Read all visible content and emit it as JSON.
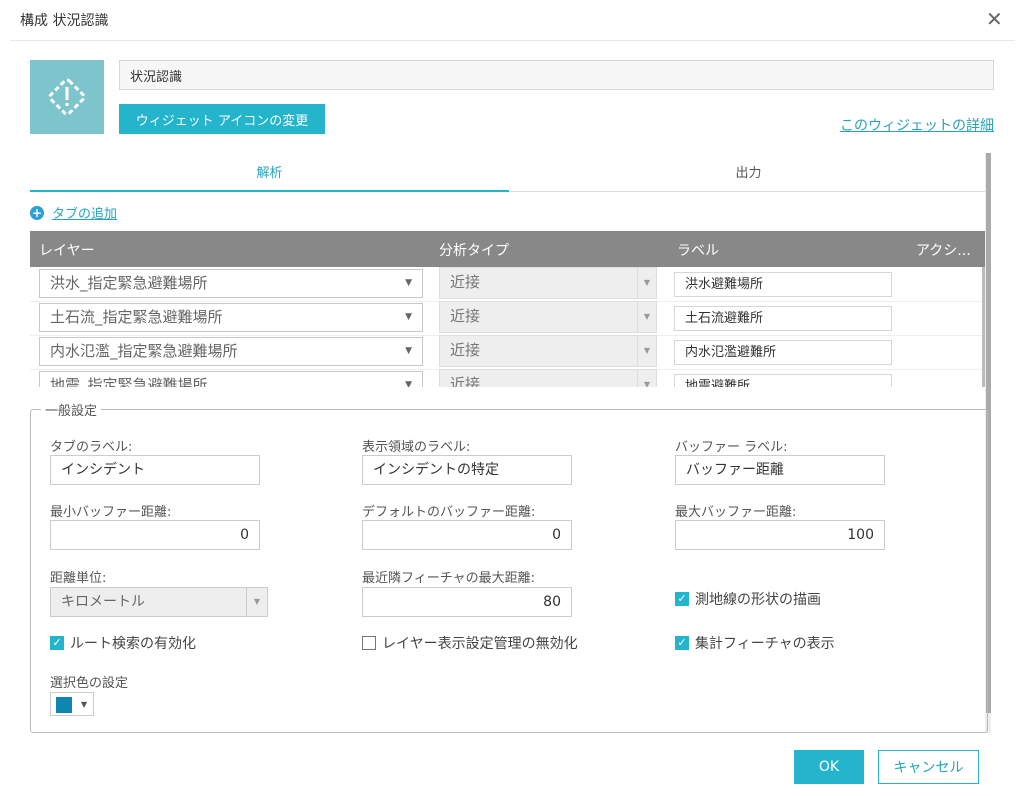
{
  "dialog": {
    "title": "構成 状況認識",
    "close_icon": "close-icon"
  },
  "widget": {
    "name": "状況認識",
    "change_icon_label": "ウィジェット アイコンの変更",
    "detail_link": "このウィジェットの詳細",
    "icon_color": "#7ec4cd"
  },
  "tabs": [
    {
      "label": "解析",
      "active": true
    },
    {
      "label": "出力",
      "active": false
    }
  ],
  "add_tab_label": "タブの追加",
  "table": {
    "headers": [
      "レイヤー",
      "分析タイプ",
      "ラベル",
      "アクシ..."
    ],
    "rows": [
      {
        "layer": "洪水_指定緊急避難場所",
        "type": "近接",
        "label": "洪水避難場所"
      },
      {
        "layer": "土石流_指定緊急避難場所",
        "type": "近接",
        "label": "土石流避難所"
      },
      {
        "layer": "内水氾濫_指定緊急避難場所",
        "type": "近接",
        "label": "内水氾濫避難所"
      },
      {
        "layer": "地震_指定緊急避難場所",
        "type": "近接",
        "label": "地震避難所"
      }
    ]
  },
  "general": {
    "legend": "一般設定",
    "tab_label": {
      "label": "タブのラベル:",
      "value": "インシデント"
    },
    "display_area_label": {
      "label": "表示領域のラベル:",
      "value": "インシデントの特定"
    },
    "buffer_label": {
      "label": "バッファー ラベル:",
      "value": "バッファー距離"
    },
    "min_buffer": {
      "label": "最小バッファー距離:",
      "value": "0"
    },
    "default_buffer": {
      "label": "デフォルトのバッファー距離:",
      "value": "0"
    },
    "max_buffer": {
      "label": "最大バッファー距離:",
      "value": "100"
    },
    "distance_unit": {
      "label": "距離単位:",
      "value": "キロメートル"
    },
    "nearest_max": {
      "label": "最近隣フィーチャの最大距離:",
      "value": "80"
    },
    "geodesic": {
      "label": "測地線の形状の描画",
      "checked": true
    },
    "route": {
      "label": "ルート検索の有効化",
      "checked": true
    },
    "layer_visibility": {
      "label": "レイヤー表示設定管理の無効化",
      "checked": false
    },
    "summary": {
      "label": "集計フィーチャの表示",
      "checked": true
    },
    "selection_color": {
      "label": "選択色の設定",
      "color": "#0e86b0"
    }
  },
  "footer": {
    "ok": "OK",
    "cancel": "キャンセル"
  },
  "accent_color": "#24b5cc"
}
